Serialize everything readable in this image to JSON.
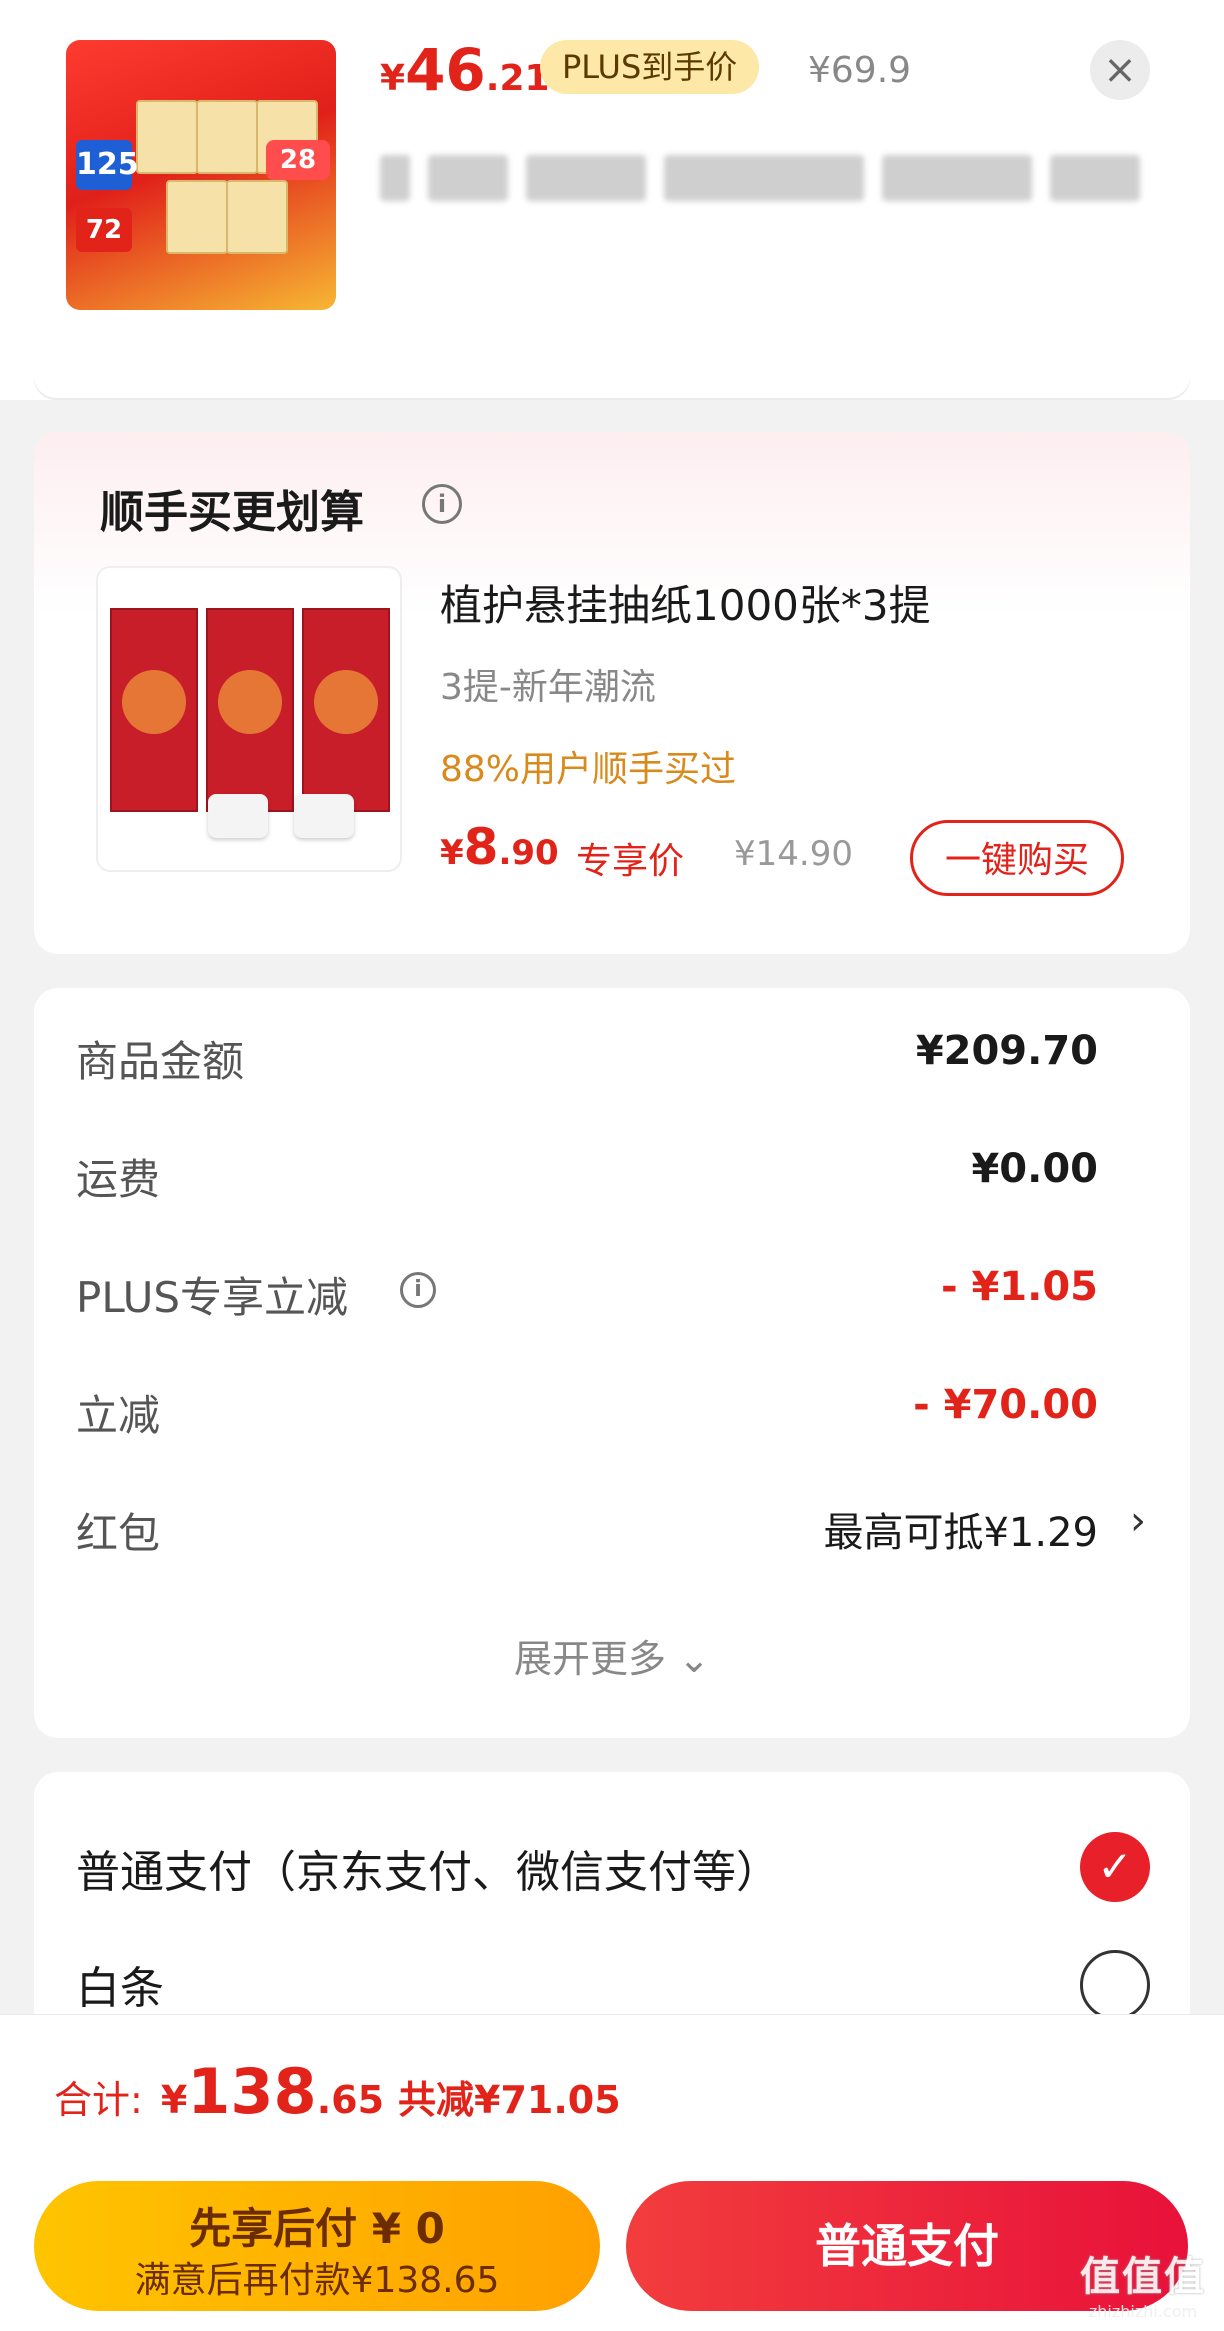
{
  "product": {
    "price_yen": "¥",
    "price_int": "46",
    "price_dec": ".21",
    "plus_tag": "PLUS到手价",
    "original_price": "¥69.9",
    "close_icon": "close-icon"
  },
  "upsell": {
    "title": "顺手买更划算",
    "item_name": "植护悬挂抽纸1000张*3提",
    "item_spec": "3提-新年潮流",
    "social_proof": "88%用户顺手买过",
    "price_yen": "¥",
    "price_int": "8",
    "price_dec": ".90",
    "price_tag": "专享价",
    "original_price": "¥14.90",
    "buy_button": "一键购买"
  },
  "summary": {
    "rows": [
      {
        "label": "商品金额",
        "value": "¥209.70"
      },
      {
        "label": "运费",
        "value": "¥0.00"
      },
      {
        "label": "PLUS专享立减",
        "value": "- ¥1.05"
      },
      {
        "label": "立减",
        "value": "- ¥70.00"
      },
      {
        "label": "红包",
        "value": "最高可抵¥1.29"
      }
    ],
    "expand_label": "展开更多",
    "expand_chevron": "⌄"
  },
  "payment": {
    "options": [
      {
        "label": "普通支付（京东支付、微信支付等）",
        "selected": true
      },
      {
        "label": "白条",
        "selected": false
      }
    ]
  },
  "footer": {
    "total_label": "合计:",
    "total_yen": "¥",
    "total_int": "138",
    "total_dec": ".65",
    "total_saved": "共减¥71.05",
    "later_line1": "先享后付 ¥ 0",
    "later_line2": "满意后再付款¥138.65",
    "pay_button": "普通支付"
  },
  "watermark": {
    "line1": "值值值",
    "line2": "zhizhizhi.com"
  },
  "colors": {
    "accent_red": "#e2231a",
    "plus_gold": "#fde8a8",
    "later_yellow": "#ffb300"
  }
}
